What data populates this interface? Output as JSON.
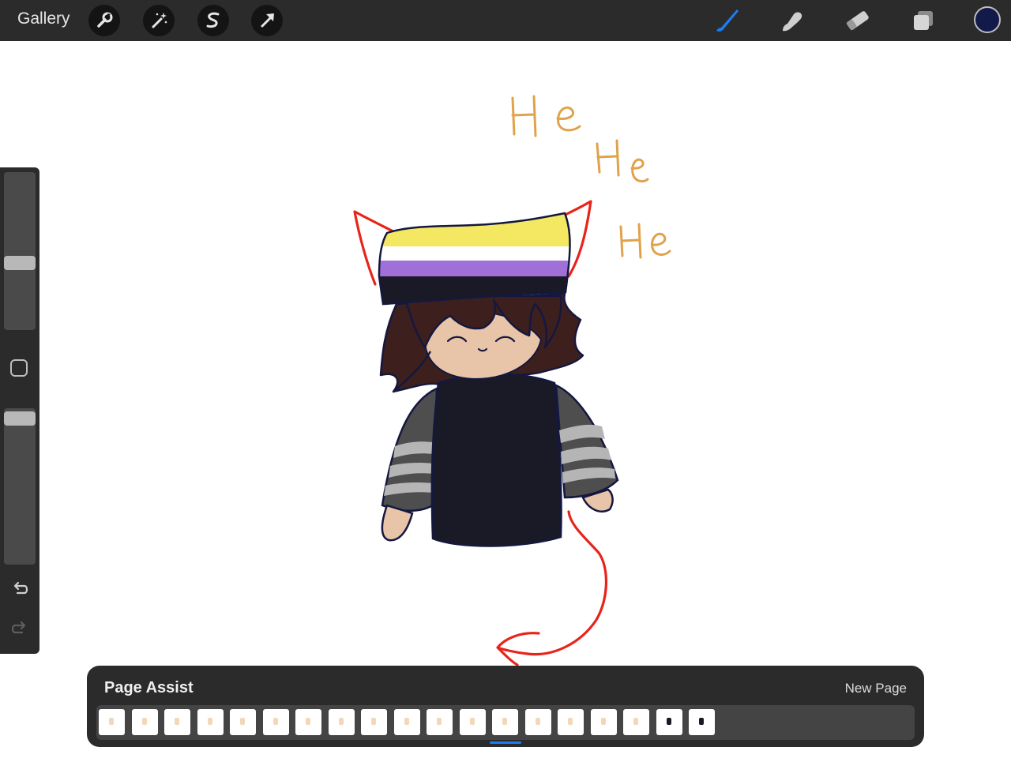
{
  "app": {
    "gallery_label": "Gallery"
  },
  "toolbar": {
    "left_tools": [
      "wrench-icon",
      "magic-wand-icon",
      "selection-icon",
      "transform-arrow-icon"
    ],
    "right_tools": [
      "brush-icon",
      "smudge-icon",
      "eraser-icon",
      "layers-icon"
    ],
    "active_tool": "brush-icon",
    "active_color": "#121a4a",
    "accent": "#1e7cf0"
  },
  "sidebar": {
    "brush_size_level": 0.42,
    "opacity_level": 0.98,
    "icons": [
      "modify-square-icon",
      "undo-icon",
      "redo-icon"
    ]
  },
  "canvas": {
    "handwriting": [
      "He",
      "He",
      "He"
    ]
  },
  "page_assist": {
    "title": "Page Assist",
    "new_page_label": "New Page",
    "page_count": 19,
    "active_page_index": 12
  }
}
